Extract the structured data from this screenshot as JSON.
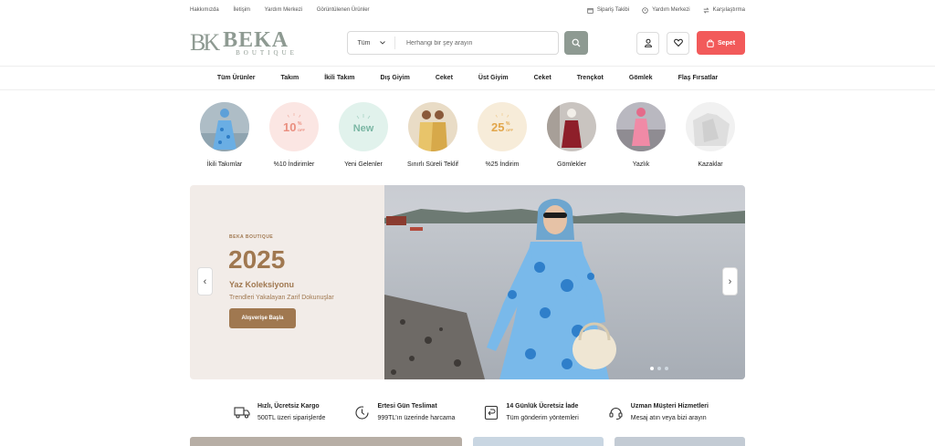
{
  "topbar": {
    "left_links": [
      "Hakkımızda",
      "İletişim",
      "Yardım Merkezi",
      "Görüntülenen Ürünler"
    ],
    "right_links": [
      {
        "label": "Sipariş Takibi",
        "icon": "package-icon"
      },
      {
        "label": "Yardım Merkezi",
        "icon": "help-icon"
      },
      {
        "label": "Karşılaştırma",
        "icon": "compare-icon"
      }
    ]
  },
  "header": {
    "logo_mark": "BK",
    "logo_title": "BEKA",
    "logo_subtitle": "BOUTIQUE",
    "search_category": "Tüm",
    "search_placeholder": "Herhangi bir şey arayın",
    "cart_label": "Sepet"
  },
  "nav": {
    "items": [
      "Tüm Ürünler",
      "Takım",
      "İkili Takım",
      "Dış Giyim",
      "Ceket",
      "Üst Giyim",
      "Ceket",
      "Trençkot",
      "Gömlek",
      "Flaş Fırsatlar"
    ]
  },
  "categories": [
    {
      "label": "İkili Takımlar",
      "kind": "photo",
      "bg": "#b7c9d6"
    },
    {
      "label": "%10 İndirimler",
      "kind": "badge",
      "badge": "10",
      "badge_sup": "%",
      "badge_sub": "OFF",
      "bg": "#fbe6e3",
      "fg": "#ea8f80"
    },
    {
      "label": "Yeni Gelenler",
      "kind": "new",
      "badge": "New",
      "bg": "#e1f2ec",
      "fg": "#7bb7a4"
    },
    {
      "label": "Sınırlı Süreli Teklif",
      "kind": "photo",
      "bg": "#d8c7a8"
    },
    {
      "label": "%25 İndirim",
      "kind": "badge",
      "badge": "25",
      "badge_sup": "%",
      "badge_sub": "OFF",
      "bg": "#f7ecd9",
      "fg": "#e2a64b"
    },
    {
      "label": "Gömlekler",
      "kind": "photo",
      "bg": "#c9c4c0"
    },
    {
      "label": "Yazlık",
      "kind": "photo",
      "bg": "#c5bfc2"
    },
    {
      "label": "Kazaklar",
      "kind": "photo",
      "bg": "#e6e6e6"
    }
  ],
  "hero": {
    "brand": "BEKA BOUTIQUE",
    "year": "2025",
    "subtitle": "Yaz Koleksiyonu",
    "description": "Trendleri Yakalayan Zarif Dokunuşlar",
    "cta": "Alışverişe Başla",
    "prev": "‹",
    "next": "›",
    "slides": 3,
    "active_slide": 1
  },
  "features": [
    {
      "icon": "truck-icon",
      "title": "Hızlı, Ücretsiz Kargo",
      "desc": "500TL üzeri siparişlerde"
    },
    {
      "icon": "clock-icon",
      "title": "Ertesi Gün Teslimat",
      "desc": "999TL'ın üzerinde harcama"
    },
    {
      "icon": "return-icon",
      "title": "14 Günlük Ücretsiz İade",
      "desc": "Tüm gönderim yöntemleri"
    },
    {
      "icon": "support-icon",
      "title": "Uzman Müşteri Hizmetleri",
      "desc": "Mesaj atın veya bizi arayın"
    }
  ],
  "colors": {
    "brand": "#8e9a92",
    "accent": "#a07850",
    "cart": "#f25a5a"
  }
}
